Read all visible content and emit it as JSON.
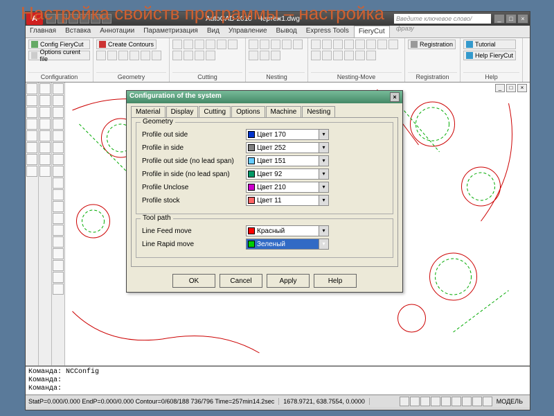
{
  "slide": {
    "title": "Настройка свойств программы – настройка"
  },
  "header": {
    "app": "AutoCAD 2010",
    "file": "Чертеж1.dwg",
    "search_placeholder": "Введите ключевое слово/фразу"
  },
  "ribbon_tabs": [
    "Главная",
    "Вставка",
    "Аннотации",
    "Параметризация",
    "Вид",
    "Управление",
    "Вывод",
    "Express Tools",
    "FieryCut"
  ],
  "ribbon_active": 8,
  "panels": [
    {
      "title": "Configuration",
      "items": [
        "Config FieryCut",
        "Options curent file"
      ]
    },
    {
      "title": "Geometry",
      "items": [
        "Create Contours"
      ]
    },
    {
      "title": "Cutting",
      "items": []
    },
    {
      "title": "Nesting",
      "items": []
    },
    {
      "title": "Nesting-Move",
      "items": []
    },
    {
      "title": "Registration",
      "items": [
        "Registration"
      ]
    },
    {
      "title": "Help",
      "items": [
        "Tutorial",
        "Help FieryCut"
      ]
    }
  ],
  "dialog": {
    "title": "Configuration of the system",
    "tabs": [
      "Material",
      "Display",
      "Cutting",
      "Options",
      "Machine",
      "Nesting"
    ],
    "active_tab": 1,
    "groups": [
      {
        "legend": "Geometry",
        "rows": [
          {
            "label": "Profile out side",
            "value": "Цвет 170",
            "color": "#0033cc"
          },
          {
            "label": "Profile in side",
            "value": "Цвет 252",
            "color": "#808080"
          },
          {
            "label": "Profile out side (no lead span)",
            "value": "Цвет 151",
            "color": "#66ccff"
          },
          {
            "label": "Profile in side (no lead span)",
            "value": "Цвет 92",
            "color": "#009966"
          },
          {
            "label": "Profile Unclose",
            "value": "Цвет 210",
            "color": "#cc00cc"
          },
          {
            "label": "Profile stock",
            "value": "Цвет 11",
            "color": "#ff6666"
          }
        ]
      },
      {
        "legend": "Tool path",
        "rows": [
          {
            "label": "Line Feed move",
            "value": "Красный",
            "color": "#ff0000"
          },
          {
            "label": "Line Rapid move",
            "value": "Зеленый",
            "color": "#00cc00",
            "selected": true
          }
        ]
      }
    ],
    "buttons": [
      "OK",
      "Cancel",
      "Apply",
      "Help"
    ]
  },
  "cmd": [
    "Команда: NCConfig",
    "Команда:",
    "Команда:"
  ],
  "status": {
    "left": "StatP=0.000/0.000  EndP=0.000/0.000  Contour=0/608/188  736/796 Time=257min14.2sec",
    "coords": "1678.9721, 638.7554, 0.0000",
    "mode": "МОДЕЛЬ"
  }
}
